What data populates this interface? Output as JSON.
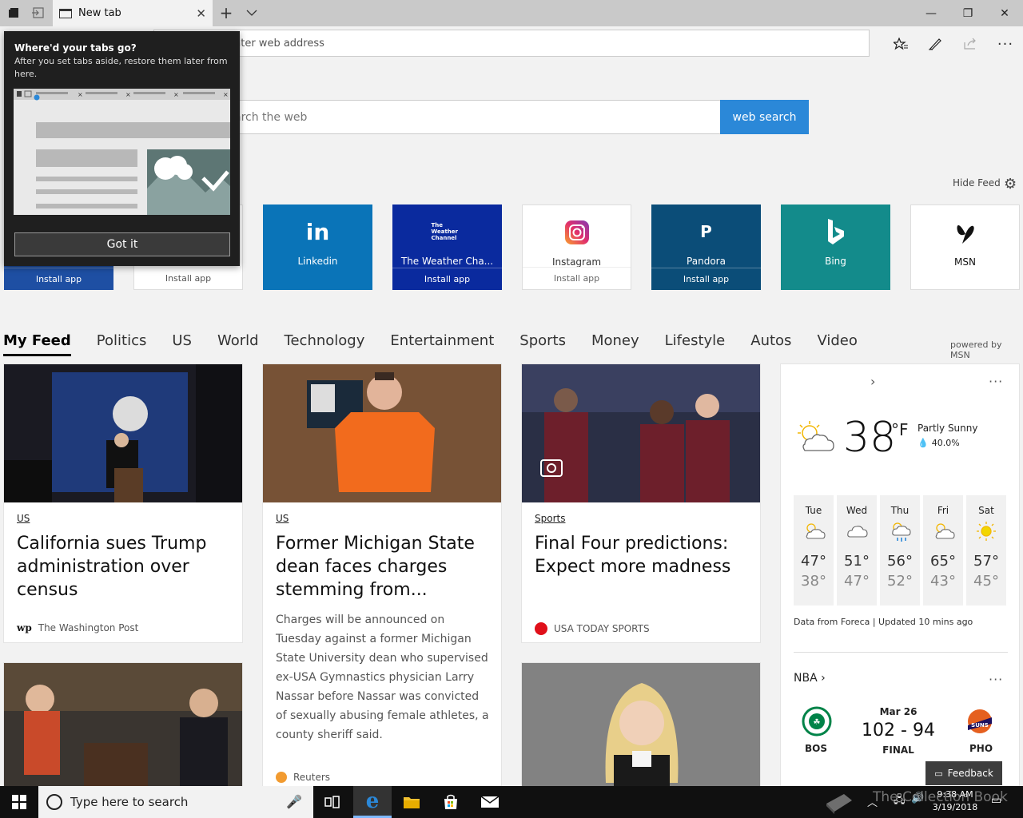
{
  "window": {
    "tab_title": "New tab",
    "minimize": "—",
    "maximize": "❐",
    "close": "✕"
  },
  "address_bar": {
    "placeholder": "nter web address"
  },
  "search": {
    "placeholder": "arch the web",
    "button": "web search"
  },
  "hide_feed": "Hide Feed",
  "popup": {
    "title": "Where'd your tabs go?",
    "body": "After you set tabs aside, restore them later from here.",
    "button": "Got it"
  },
  "tiles": [
    {
      "name": "",
      "install": "Install app",
      "bg": "#1e4fa3",
      "fg": "#ffffff"
    },
    {
      "name": "",
      "install": "Install app",
      "bg": "#ffffff",
      "fg": "#555555"
    },
    {
      "name": "Linkedin",
      "logo": "in",
      "install": "",
      "bg": "#0a74b8",
      "fg": "#ffffff"
    },
    {
      "name": "The Weather Cha...",
      "logo": "The Weather Channel",
      "install": "Install app",
      "bg": "#0a2a9e",
      "fg": "#ffffff"
    },
    {
      "name": "Instagram",
      "logo": "instagram-icon",
      "install": "Install app",
      "bg": "#ffffff",
      "fg": "#333333"
    },
    {
      "name": "Pandora",
      "logo": "P",
      "install": "Install app",
      "bg": "#0b4d78",
      "fg": "#ffffff"
    },
    {
      "name": "Bing",
      "logo": "b",
      "install": "",
      "bg": "#138b8b",
      "fg": "#ffffff"
    },
    {
      "name": "MSN",
      "logo": "butterfly-icon",
      "install": "",
      "bg": "#ffffff",
      "fg": "#111111"
    }
  ],
  "feed_nav": [
    "My Feed",
    "Politics",
    "US",
    "World",
    "Technology",
    "Entertainment",
    "Sports",
    "Money",
    "Lifestyle",
    "Autos",
    "Video"
  ],
  "powered_by": "powered by MSN",
  "cards": [
    {
      "category": "US",
      "headline": "California sues Trump administration over census",
      "source": "The Washington Post",
      "source_logo": "wp"
    },
    {
      "category": "US",
      "headline": "Former Michigan State dean faces charges stemming from...",
      "description": "Charges will be announced on Tuesday against a former Michigan State University dean who supervised ex-USA Gymnastics physician Larry Nassar before Nassar was convicted of sexually abusing female athletes, a county sheriff said.",
      "source": "Reuters"
    },
    {
      "category": "Sports",
      "headline": "Final Four predictions: Expect more madness",
      "source": "USA TODAY SPORTS"
    }
  ],
  "weather": {
    "temp": "38",
    "unit": "°F",
    "condition": "Partly Sunny",
    "precip": "40.0%",
    "forecast": [
      {
        "day": "Tue",
        "hi": "47°",
        "lo": "38°",
        "icon": "sun-cloud-icon"
      },
      {
        "day": "Wed",
        "hi": "51°",
        "lo": "47°",
        "icon": "cloud-icon"
      },
      {
        "day": "Thu",
        "hi": "56°",
        "lo": "52°",
        "icon": "rain-icon"
      },
      {
        "day": "Fri",
        "hi": "65°",
        "lo": "43°",
        "icon": "sun-cloud-icon"
      },
      {
        "day": "Sat",
        "hi": "57°",
        "lo": "45°",
        "icon": "sun-icon"
      }
    ],
    "credit": "Data from Foreca | Updated 10 mins ago"
  },
  "nba": {
    "title": "NBA",
    "date": "Mar 26",
    "score": "102 - 94",
    "status": "FINAL",
    "home": "BOS",
    "away": "PHO"
  },
  "feedback": "Feedback",
  "taskbar": {
    "search_placeholder": "Type here to search",
    "time": "9:38 AM",
    "date": "3/19/2018"
  },
  "watermark": "The Collection Book",
  "colors": {
    "accent": "#2b88d8"
  }
}
